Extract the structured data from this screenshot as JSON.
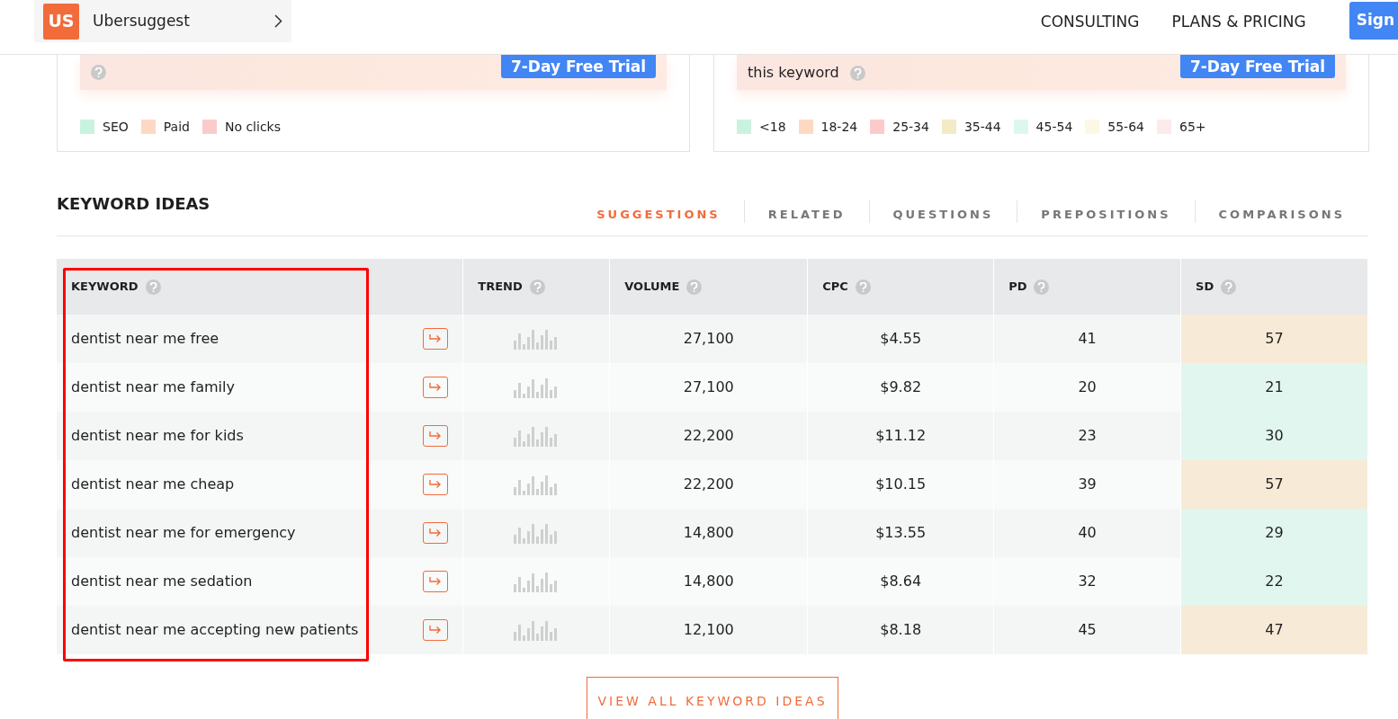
{
  "header": {
    "logo": "US",
    "app_name": "Ubersuggest",
    "nav": [
      "CONSULTING",
      "PLANS & PRICING"
    ],
    "signin": "Sign"
  },
  "cards": [
    {
      "button": "7-Day Free Trial",
      "legend": [
        {
          "label": "SEO",
          "color": "#c9f2e1"
        },
        {
          "label": "Paid",
          "color": "#fdd9c4"
        },
        {
          "label": "No clicks",
          "color": "#fbcaca"
        }
      ]
    },
    {
      "text": "this keyword",
      "button": "7-Day Free Trial",
      "legend": [
        {
          "label": "<18",
          "color": "#c9f2e1"
        },
        {
          "label": "18-24",
          "color": "#fdd9c4"
        },
        {
          "label": "25-34",
          "color": "#fbcaca"
        },
        {
          "label": "35-44",
          "color": "#f3eac6"
        },
        {
          "label": "45-54",
          "color": "#dcf8ee"
        },
        {
          "label": "55-64",
          "color": "#fdf7e6"
        },
        {
          "label": "65+",
          "color": "#fdeaea"
        }
      ]
    }
  ],
  "keyword_ideas": {
    "title": "KEYWORD IDEAS",
    "tabs": [
      {
        "label": "SUGGESTIONS",
        "selected": true
      },
      {
        "label": "RELATED",
        "selected": false
      },
      {
        "label": "QUESTIONS",
        "selected": false
      },
      {
        "label": "PREPOSITIONS",
        "selected": false
      },
      {
        "label": "COMPARISONS",
        "selected": false
      }
    ],
    "columns": [
      "KEYWORD",
      "TREND",
      "VOLUME",
      "CPC",
      "PD",
      "SD"
    ],
    "highlight_keyword_column": true,
    "rows": [
      {
        "keyword": "dentist near me free",
        "volume": "27,100",
        "cpc": "$4.55",
        "pd": "41",
        "sd": "57",
        "color": "#f7ead7"
      },
      {
        "keyword": "dentist near me family",
        "volume": "27,100",
        "cpc": "$9.82",
        "pd": "20",
        "sd": "21",
        "color": "#e1f6ee"
      },
      {
        "keyword": "dentist near me for kids",
        "volume": "22,200",
        "cpc": "$11.12",
        "pd": "23",
        "sd": "30",
        "color": "#e1f6ee"
      },
      {
        "keyword": "dentist near me cheap",
        "volume": "22,200",
        "cpc": "$10.15",
        "pd": "39",
        "sd": "57",
        "color": "#f7ead7"
      },
      {
        "keyword": "dentist near me for emergency",
        "volume": "14,800",
        "cpc": "$13.55",
        "pd": "40",
        "sd": "29",
        "color": "#e1f6ee"
      },
      {
        "keyword": "dentist near me sedation",
        "volume": "14,800",
        "cpc": "$8.64",
        "pd": "32",
        "sd": "22",
        "color": "#e1f6ee"
      },
      {
        "keyword": "dentist near me accepting new patients",
        "volume": "12,100",
        "cpc": "$8.18",
        "pd": "45",
        "sd": "47",
        "color": "#f7ead7"
      }
    ],
    "view_all": "VIEW ALL KEYWORD IDEAS"
  }
}
